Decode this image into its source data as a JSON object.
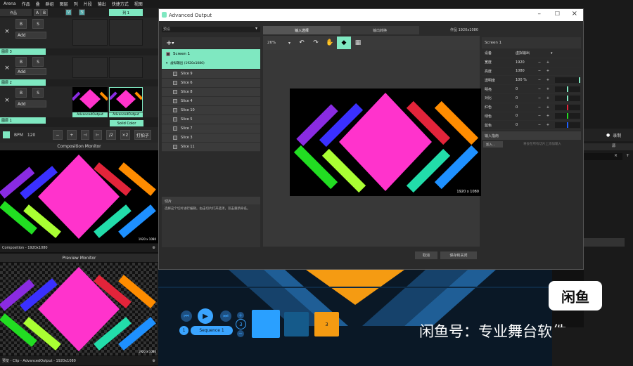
{
  "menubar": [
    "Arena",
    "作品",
    "叠",
    "群组",
    "图层",
    "列",
    "片段",
    "输出",
    "快捷方式",
    "视图"
  ],
  "layers": {
    "names": [
      "图层 3",
      "图层 2",
      "图层 1"
    ],
    "add_label": "Add",
    "clip_labels": [
      "AdvancedOutput",
      "AdvancedOutput"
    ],
    "solid_color": "Solid Color",
    "top_label": "作品",
    "column_label": "列 1",
    "btn_b": "B",
    "btn_s": "S",
    "btn_x": "×",
    "btn_a": "A",
    "btn_m": "M",
    "btn_v": "V"
  },
  "transport": {
    "bpm_label": "BPM",
    "bpm": "120",
    "minus": "−",
    "plus": "+",
    "half": "/2",
    "double": "×2",
    "tap": "打拍子"
  },
  "composition_monitor": {
    "title": "Composition Monitor",
    "footer": "Composition - 1920x1080",
    "res": "1920 x 1080"
  },
  "preview_monitor": {
    "title": "Preview Monitor",
    "footer": "预览 - Clip - AdvancedOutput - 1920x1080",
    "res": "1920 x 1080"
  },
  "dialog": {
    "title": "Advanced Output",
    "preset": "预设",
    "tabs": [
      "输入选择",
      "输出转换"
    ],
    "comp_label": "作品 1920x1080",
    "zoom": "26%",
    "screen_name": "Screen 1",
    "virtual": "虚拟输出 (1920x1080)",
    "slices": [
      "Slice 9",
      "Slice 6",
      "Slice 8",
      "Slice 4",
      "Slice 10",
      "Slice 5",
      "Slice 7",
      "Slice 3",
      "Slice 11"
    ],
    "help_title": "切片",
    "help_text": "选择这个切片进行编辑。右击切片打开选项，双击重新命名。",
    "canvas_res": "1920 x 1080",
    "right_title": "Screen 1",
    "props": [
      {
        "k": "设备",
        "v": "虚拟输出"
      },
      {
        "k": "宽度",
        "v": "1920"
      },
      {
        "k": "高度",
        "v": "1080"
      },
      {
        "k": "透明度",
        "v": "100 %"
      },
      {
        "k": "明亮",
        "v": "0"
      },
      {
        "k": "对比",
        "v": "0"
      },
      {
        "k": "红色",
        "v": "0"
      },
      {
        "k": "绿色",
        "v": "0"
      },
      {
        "k": "蓝色",
        "v": "0"
      }
    ],
    "input_map": "输入指南",
    "input_add": "加入...",
    "input_hint": "将会在所有切片上添加输入",
    "cancel": "取消",
    "save": "保存和关闭",
    "colors": {
      "accent": "#7fe8c1",
      "magenta": "#ff33cc"
    }
  },
  "right_panel": {
    "record": "录制",
    "tab": "源"
  },
  "promo": {
    "sequence": "Sequence 1",
    "num1": "1",
    "num3": "3",
    "box_num": "3",
    "brand": "闲鱼",
    "watermark": "闲鱼号：专业舞台软件"
  }
}
